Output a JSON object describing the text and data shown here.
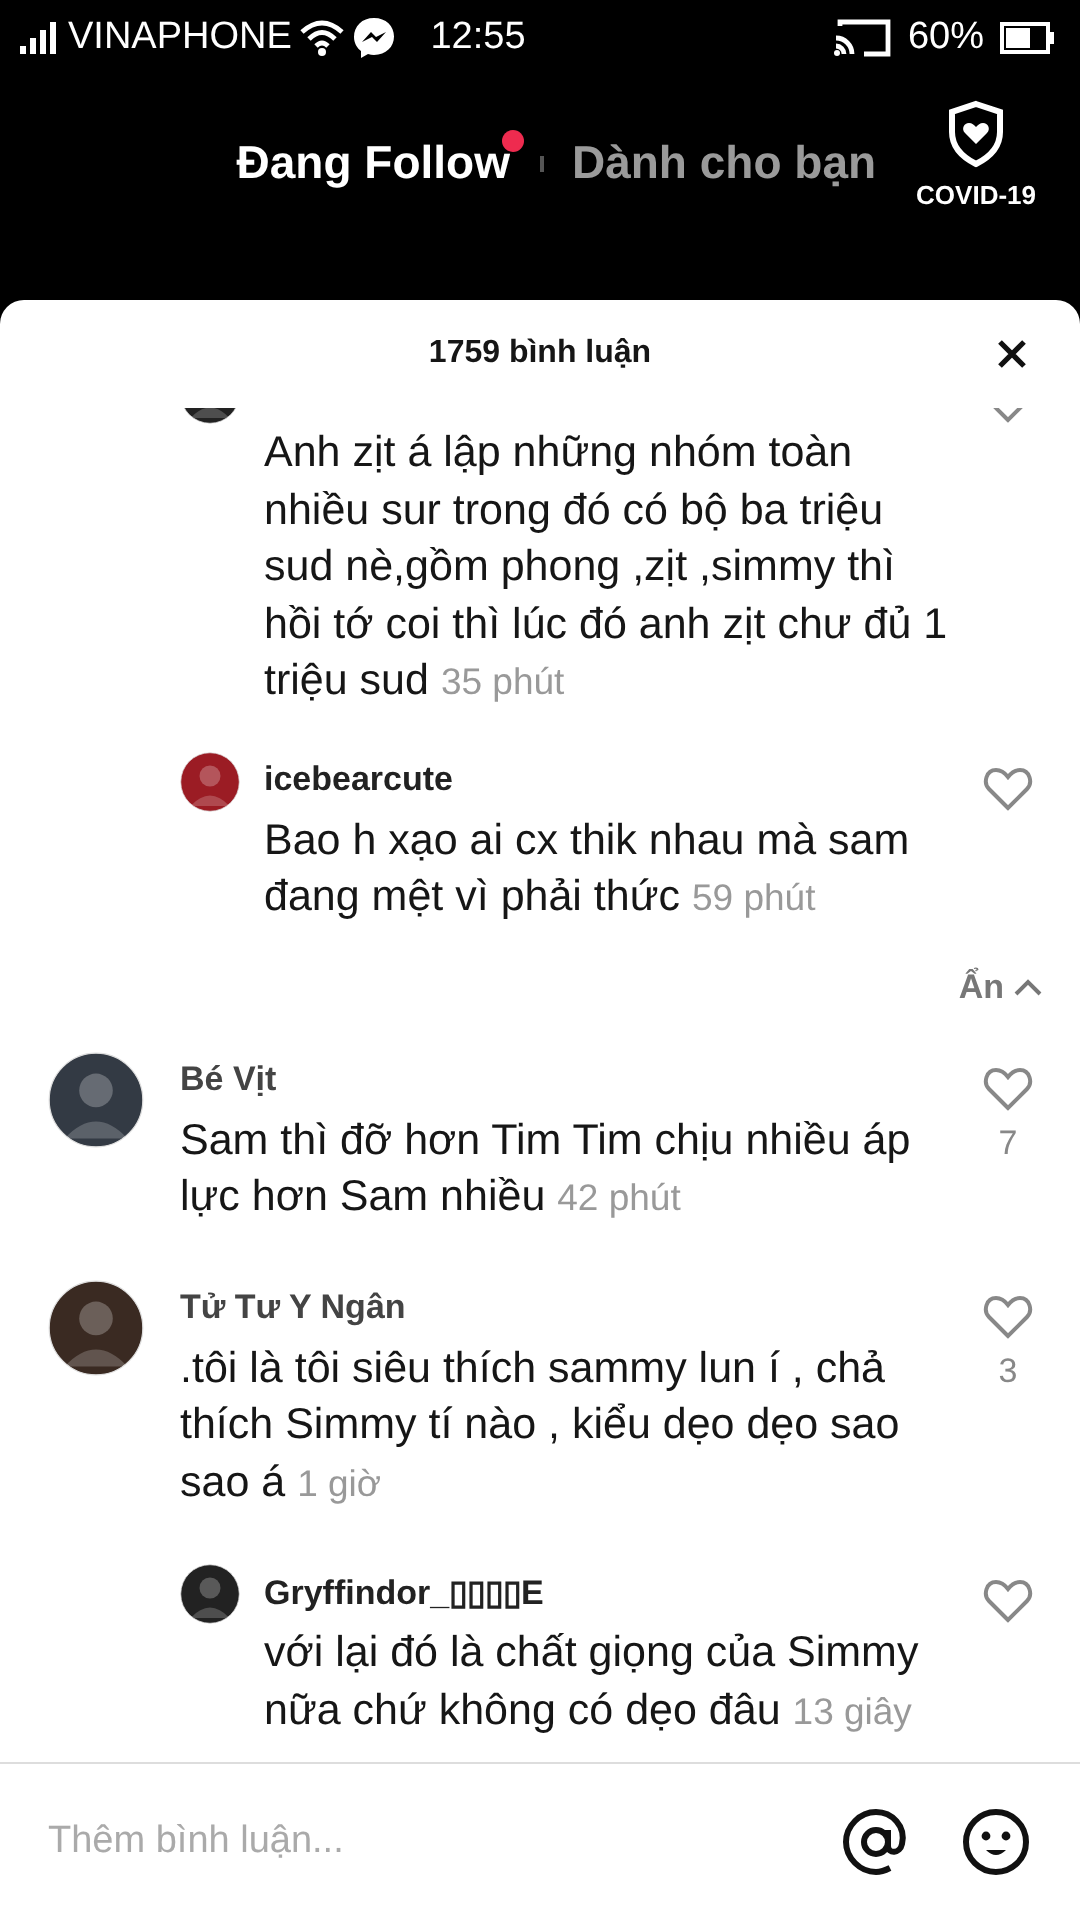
{
  "status_bar": {
    "carrier": "VINAPHONE",
    "time": "12:55",
    "battery": "60%"
  },
  "tabs": [
    {
      "label": "Đang Follow",
      "selected": true,
      "dot": true
    },
    {
      "label": "Dành cho bạn",
      "selected": false,
      "dot": false
    }
  ],
  "covid_button": {
    "label": "COVID-19"
  },
  "comments_sheet": {
    "title": "1759 bình luận",
    "comments": [
      {
        "kind": "reply",
        "text": "Anh zịt á lập những nhóm toàn nhiều sur trong đó có bộ ba triệu sud nè,gồm phong ,zịt ,simmy thì hồi tớ coi thì lúc đó anh zịt chư đủ 1 triệu sud",
        "time": "35 phút"
      },
      {
        "kind": "reply",
        "name": "icebearcute",
        "text": "Bao h xạo ai cx thik nhau mà sam đang mệt vì phải thức",
        "time": "59 phút"
      },
      {
        "kind": "hide",
        "label": "Ẩn"
      },
      {
        "kind": "comment",
        "name": "Bé Vịt",
        "text": "Sam thì đỡ hơn Tim Tim chịu nhiều áp lực hơn Sam nhiều",
        "time": "42 phút",
        "likes": "7"
      },
      {
        "kind": "comment",
        "name": "Tử Tư Y Ngân",
        "text": ".tôi là tôi siêu thích sammy lun í , chả thích Simmy tí nào , kiểu dẹo dẹo sao sao á",
        "time": "1 giờ",
        "likes": "3"
      },
      {
        "kind": "reply",
        "name": "Gryffindor_▯▯▯▯E",
        "text": "với lại đó là chất giọng của Simmy nữa chứ không có dẹo đâu",
        "time": "13 giây"
      }
    ],
    "input": {
      "placeholder": "Thêm bình luận..."
    }
  }
}
